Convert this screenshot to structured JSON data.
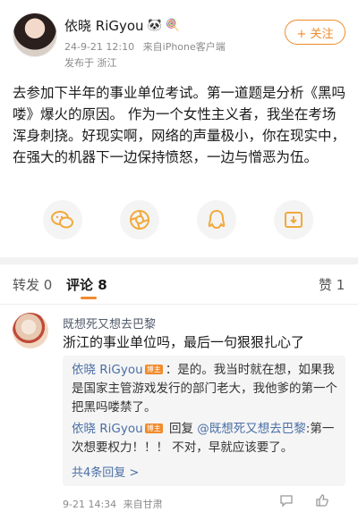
{
  "post": {
    "author_name": "依晓 RiGyou",
    "badge_emoji_1": "🐼",
    "badge_emoji_2": "🍭",
    "date": "24-9-21 12:10",
    "source": "来自iPhone客户端",
    "location": "发布于 浙江",
    "follow_label": "+ 关注",
    "body": "去参加下半年的事业单位考试。第一道题是分析《黑吗喽》爆火的原因。 作为一个女性主义者，我坐在考场浑身刺挠。好现实啊，网络的声量极小，你在现实中，在强大的机器下一边保持愤怒，一边与憎恶为伍。"
  },
  "share": {
    "icons": [
      "wechat-icon",
      "moments-icon",
      "qq-icon",
      "save-image-icon"
    ],
    "accent": "#f2a93b"
  },
  "tabs": {
    "repost": "转发 0",
    "comment": "评论 8",
    "like": "赞 1"
  },
  "comment": {
    "author": "既想死又想去巴黎",
    "text": "浙江的事业单位吗，最后一句狠狠扎心了",
    "date": "9-21 14:34",
    "source": "来自甘肃",
    "replies": [
      {
        "name": "依晓 RiGyou",
        "badge": "博主",
        "text": "：是的。我当时就在想，如果我是国家主管游戏发行的部门老大，我他爹的第一个把黑吗喽禁了。"
      },
      {
        "name": "依晓 RiGyou",
        "badge": "博主",
        "prefix": " 回复 ",
        "mention": "@既想死又想去巴黎",
        "text": ":第一次想要权力！！！ 不对，早就应该要了。"
      }
    ],
    "more_replies": "共4条回复 >"
  },
  "colors": {
    "accent": "#f08b2b",
    "link": "#4a6fa5",
    "muted": "#8a8a8a"
  }
}
